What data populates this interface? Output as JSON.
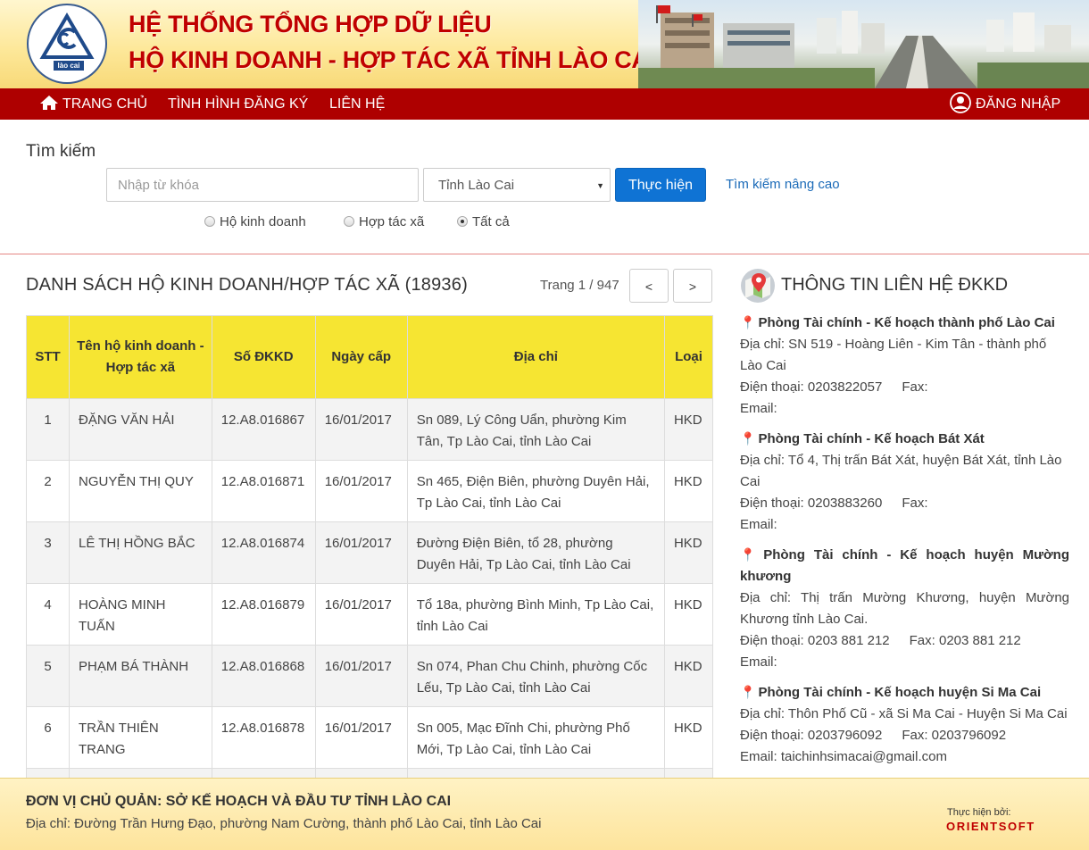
{
  "header": {
    "title_line1": "HỆ THỐNG TỔNG HỢP DỮ LIỆU",
    "title_line2": "HỘ KINH DOANH - HỢP TÁC XÃ TỈNH LÀO CAI",
    "logo_text": "lào cai"
  },
  "nav": {
    "home": "TRANG CHỦ",
    "status": "TÌNH HÌNH ĐĂNG KÝ",
    "contact": "LIÊN HỆ",
    "login": "ĐĂNG NHẬP"
  },
  "search": {
    "label": "Tìm kiếm",
    "placeholder": "Nhập từ khóa",
    "province": "Tỉnh Lào Cai",
    "submit": "Thực hiện",
    "advanced": "Tìm kiếm nâng cao",
    "radios": [
      "Hộ kinh doanh",
      "Hợp tác xã",
      "Tất cả"
    ],
    "selected": "Tất cả"
  },
  "list": {
    "title": "DANH SÁCH HỘ KINH DOANH/HỢP TÁC XÃ (18936)",
    "page_info": "Trang 1 / 947",
    "prev": "<",
    "next": ">",
    "headers": [
      "STT",
      "Tên hộ kinh doanh - Hợp tác xã",
      "Số ĐKKD",
      "Ngày cấp",
      "Địa chỉ",
      "Loại"
    ],
    "rows": [
      [
        "1",
        "ĐẶNG VĂN HẢI",
        "12.A8.016867",
        "16/01/2017",
        "Sn 089, Lý Công Uẩn, phường Kim Tân, Tp Lào Cai, tỉnh Lào Cai",
        "HKD"
      ],
      [
        "2",
        "NGUYỄN THỊ QUY",
        "12.A8.016871",
        "16/01/2017",
        "Sn 465, Điện Biên, phường Duyên Hải, Tp Lào Cai, tỉnh Lào Cai",
        "HKD"
      ],
      [
        "3",
        "LÊ THỊ HỒNG BẮC",
        "12.A8.016874",
        "16/01/2017",
        "Đường Điện Biên, tổ 28, phường Duyên Hải, Tp Lào Cai, tỉnh Lào Cai",
        "HKD"
      ],
      [
        "4",
        "HOÀNG MINH TUẤN",
        "12.A8.016879",
        "16/01/2017",
        "Tổ 18a, phường Bình Minh, Tp Lào Cai, tỉnh Lào Cai",
        "HKD"
      ],
      [
        "5",
        "PHẠM BÁ THÀNH",
        "12.A8.016868",
        "16/01/2017",
        "Sn 074, Phan Chu Chinh, phường Cốc Lếu, Tp Lào Cai, tỉnh Lào Cai",
        "HKD"
      ],
      [
        "6",
        "TRẦN THIÊN TRANG",
        "12.A8.016878",
        "16/01/2017",
        "Sn 005, Mạc Đĩnh Chi, phường Phố Mới, Tp Lào Cai, tỉnh Lào Cai",
        "HKD"
      ]
    ]
  },
  "contact": {
    "title": "THÔNG TIN LIÊN HỆ ĐKKD",
    "offices": [
      {
        "name": "Phòng Tài chính - Kế hoạch thành phố Lào Cai",
        "address": "Địa chỉ: SN 519 - Hoàng Liên - Kim Tân - thành phố Lào Cai",
        "phone": "Điện thoại: 0203822057",
        "fax": "Fax:",
        "email": "Email:"
      },
      {
        "name": "Phòng Tài chính - Kế hoạch Bát Xát",
        "address": "Địa chỉ: Tổ 4, Thị trấn Bát Xát, huyện Bát Xát, tỉnh Lào Cai",
        "phone": "Điện thoại: 0203883260",
        "fax": "Fax:",
        "email": "Email:"
      },
      {
        "name": "Phòng Tài chính - Kế hoạch huyện Mường khương",
        "address": "Địa chỉ: Thị trấn Mường Khương, huyện Mường Khương tỉnh Lào Cai.",
        "phone": "Điện thoại: 0203 881 212",
        "fax": "Fax: 0203 881 212",
        "email": "Email:"
      },
      {
        "name": "Phòng Tài chính - Kế hoạch huyện Si Ma Cai",
        "address": "Địa chỉ: Thôn Phố Cũ - xã Si Ma Cai - Huyện Si Ma Cai",
        "phone": "Điện thoại: 0203796092",
        "fax": "Fax: 0203796092",
        "email": "Email: taichinhsimacai@gmail.com"
      }
    ]
  },
  "footer": {
    "org": "ĐƠN VỊ CHỦ QUẢN: SỞ KẾ HOẠCH VÀ ĐẦU TƯ TỈNH LÀO CAI",
    "address": "Địa chỉ: Đường Trần Hưng Đạo, phường Nam Cường, thành phố Lào Cai, tỉnh Lào Cai",
    "by": "Thực hiện bởi:",
    "brand": "ORIENTSOFT"
  }
}
